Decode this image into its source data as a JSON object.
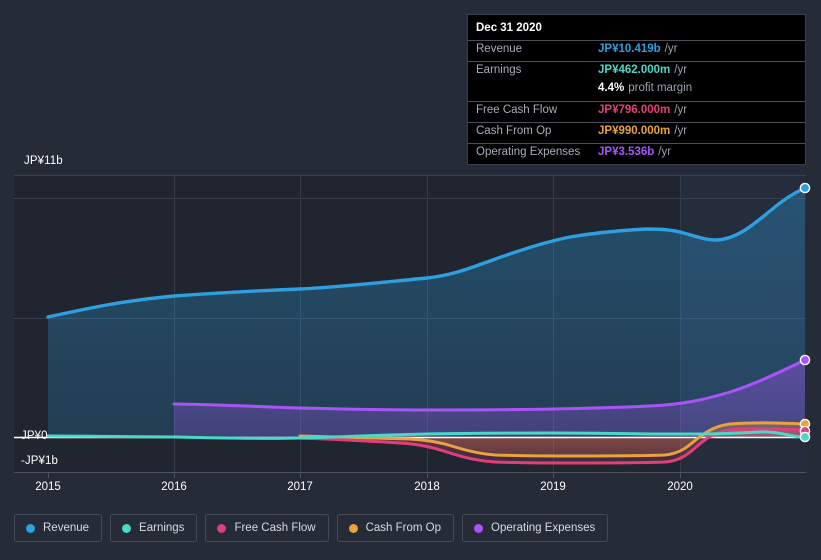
{
  "colors": {
    "background": "#262b38",
    "plot_background": "#20252f",
    "plot_background_future": "#232a3a",
    "gridline": "#3a4150",
    "zero_line": "#ffffff",
    "revenue": "#2e9fe0",
    "earnings": "#4ad9c8",
    "free_cash_flow": "#e0407a",
    "cash_from_op": "#e8a33d",
    "operating_expenses": "#a855f7",
    "tooltip_background": "#000000",
    "tooltip_border": "#3a3f4b",
    "text_muted": "#a7adb8",
    "text": "#ffffff"
  },
  "tooltip": {
    "date": "Dec 31 2020",
    "rows": [
      {
        "name": "Revenue",
        "value": "JP¥10.419b",
        "unit": "/yr",
        "color": "#2e9fe0"
      },
      {
        "name": "Earnings",
        "value": "JP¥462.000m",
        "unit": "/yr",
        "color": "#4ad9c8"
      },
      {
        "name": "Free Cash Flow",
        "value": "JP¥796.000m",
        "unit": "/yr",
        "color": "#e0407a"
      },
      {
        "name": "Cash From Op",
        "value": "JP¥990.000m",
        "unit": "/yr",
        "color": "#e8a33d"
      },
      {
        "name": "Operating Expenses",
        "value": "JP¥3.536b",
        "unit": "/yr",
        "color": "#a855f7"
      }
    ],
    "margin_value": "4.4%",
    "margin_label": "profit margin"
  },
  "legend": {
    "items": [
      {
        "label": "Revenue",
        "color": "#2e9fe0"
      },
      {
        "label": "Earnings",
        "color": "#4ad9c8"
      },
      {
        "label": "Free Cash Flow",
        "color": "#e0407a"
      },
      {
        "label": "Cash From Op",
        "color": "#e8a33d"
      },
      {
        "label": "Operating Expenses",
        "color": "#a855f7"
      }
    ]
  },
  "axis": {
    "y_top_label": "JP¥11b",
    "y_zero_label": "JP¥0",
    "y_neg_label": "-JP¥1b",
    "x_labels": [
      "2015",
      "2016",
      "2017",
      "2018",
      "2019",
      "2020"
    ]
  },
  "chart_data": {
    "type": "area",
    "title": "",
    "xlabel": "",
    "ylabel": "JP¥",
    "ylim": [
      -1,
      11
    ],
    "ytick_labels": [
      "JP¥11b",
      "JP¥0",
      "-JP¥1b"
    ],
    "ytick_values": [
      11,
      0,
      -1
    ],
    "gridlines": [
      11,
      10,
      5,
      0
    ],
    "grid": true,
    "legend_position": "bottom",
    "x": [
      "2015.0",
      "2015.5",
      "2016.0",
      "2016.5",
      "2017.0",
      "2017.5",
      "2018.0",
      "2018.5",
      "2019.0",
      "2019.5",
      "2020.0",
      "2020.5",
      "2020.95"
    ],
    "x_tick_labels": [
      "2015",
      "2016",
      "2017",
      "2018",
      "2019",
      "2020"
    ],
    "units": "JP¥ billions per year",
    "series": [
      {
        "name": "Revenue",
        "color": "#2e9fe0",
        "values": [
          5.05,
          5.45,
          5.75,
          5.85,
          5.95,
          6.3,
          6.5,
          7.1,
          8.05,
          8.45,
          8.25,
          9.1,
          10.419
        ],
        "filled": true
      },
      {
        "name": "Operating Expenses",
        "color": "#a855f7",
        "values": [
          null,
          null,
          1.4,
          1.33,
          1.28,
          1.24,
          1.2,
          1.22,
          1.3,
          1.38,
          1.55,
          2.2,
          3.536
        ],
        "filled": true,
        "starts_at": "2016"
      },
      {
        "name": "Cash From Op",
        "color": "#e8a33d",
        "values": [
          null,
          null,
          null,
          null,
          0.06,
          0.03,
          0.0,
          -0.3,
          -0.42,
          -0.44,
          -0.18,
          0.75,
          0.99
        ],
        "filled": false,
        "starts_at": "2017"
      },
      {
        "name": "Free Cash Flow",
        "color": "#e0407a",
        "values": [
          null,
          null,
          null,
          null,
          -0.02,
          -0.05,
          -0.12,
          -0.52,
          -0.65,
          -0.66,
          -0.5,
          0.55,
          0.796
        ],
        "filled": false,
        "starts_at": "2017"
      },
      {
        "name": "Earnings",
        "color": "#4ad9c8",
        "values": [
          0.04,
          0.03,
          0.02,
          0.0,
          0.04,
          0.08,
          0.1,
          0.12,
          0.14,
          0.13,
          0.1,
          0.26,
          0.462
        ],
        "filled": false
      }
    ],
    "highlight_region": {
      "from": "2020",
      "to": "end",
      "note": "lighter shaded future/recent period"
    },
    "endpoint_markers": true
  }
}
